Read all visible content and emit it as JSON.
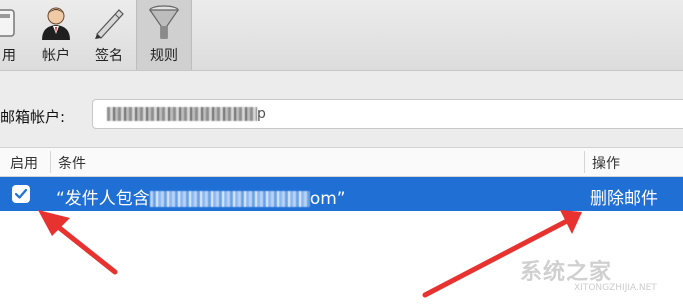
{
  "toolbar": {
    "items": [
      {
        "label": "用",
        "icon": "general-icon"
      },
      {
        "label": "帐户",
        "icon": "account-icon"
      },
      {
        "label": "签名",
        "icon": "signature-pen-icon"
      },
      {
        "label": "规则",
        "icon": "funnel-icon",
        "selected": true
      }
    ]
  },
  "account": {
    "label": "邮箱帐户:",
    "value_suffix": "p"
  },
  "table": {
    "headers": {
      "enabled": "启用",
      "condition": "条件",
      "action": "操作"
    },
    "rows": [
      {
        "enabled": true,
        "condition_prefix": "“发件人包含",
        "condition_suffix": "om”",
        "action": "删除邮件"
      }
    ]
  },
  "watermark": {
    "text": "系统之家",
    "url": "XITONGZHIJIA.NET"
  },
  "colors": {
    "selection": "#1f6fd4",
    "arrow": "#e8322f"
  }
}
